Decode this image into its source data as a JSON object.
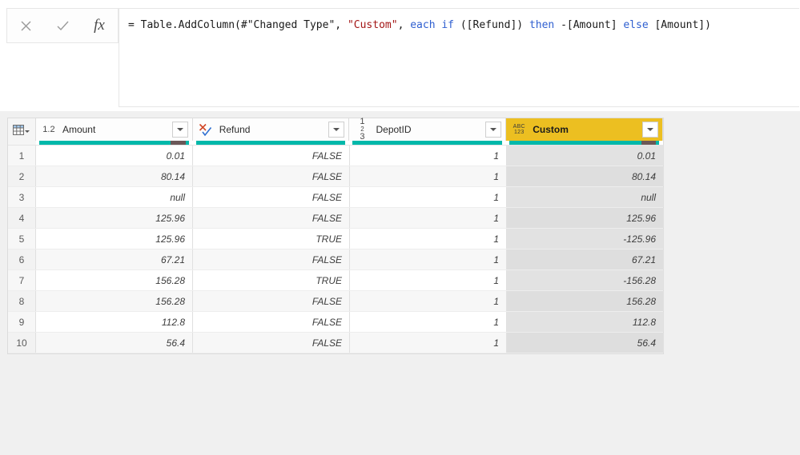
{
  "formula_bar": {
    "cancel_icon": "close-icon",
    "confirm_icon": "checkmark-icon",
    "fx_label": "fx",
    "formula_full": "= Table.AddColumn(#\"Changed Type\", \"Custom\", each if ([Refund]) then -[Amount] else [Amount])",
    "tokens": [
      {
        "text": "= Table.AddColumn(#\"Changed Type\", ",
        "kind": "plain"
      },
      {
        "text": "\"Custom\"",
        "kind": "string"
      },
      {
        "text": ", ",
        "kind": "plain"
      },
      {
        "text": "each",
        "kind": "keyword"
      },
      {
        "text": " ",
        "kind": "plain"
      },
      {
        "text": "if",
        "kind": "keyword"
      },
      {
        "text": " ([Refund]) ",
        "kind": "plain"
      },
      {
        "text": "then",
        "kind": "keyword"
      },
      {
        "text": " -[Amount] ",
        "kind": "plain"
      },
      {
        "text": "else",
        "kind": "keyword"
      },
      {
        "text": " [Amount])",
        "kind": "plain"
      }
    ]
  },
  "grid": {
    "corner_icon": "table-grid-icon",
    "columns": [
      {
        "name": "Amount",
        "type_icon": "decimal-number-icon",
        "type_glyph": "1.2",
        "selected": false,
        "quality": {
          "valid_pct": 88,
          "error_pct": 10
        }
      },
      {
        "name": "Refund",
        "type_icon": "logical-true-false-icon",
        "type_glyph": "X/check",
        "selected": false,
        "quality": {
          "valid_pct": 100,
          "error_pct": 0
        }
      },
      {
        "name": "DepotID",
        "type_icon": "whole-number-icon",
        "type_glyph": "123",
        "selected": false,
        "quality": {
          "valid_pct": 100,
          "error_pct": 0
        }
      },
      {
        "name": "Custom",
        "type_icon": "any-abc123-icon",
        "type_glyph": "ABC123",
        "selected": true,
        "quality": {
          "valid_pct": 88,
          "error_pct": 10
        }
      }
    ],
    "rows": [
      {
        "num": "1",
        "Amount": "0.01",
        "Refund": "FALSE",
        "DepotID": "1",
        "Custom": "0.01"
      },
      {
        "num": "2",
        "Amount": "80.14",
        "Refund": "FALSE",
        "DepotID": "1",
        "Custom": "80.14"
      },
      {
        "num": "3",
        "Amount": "null",
        "Refund": "FALSE",
        "DepotID": "1",
        "Custom": "null"
      },
      {
        "num": "4",
        "Amount": "125.96",
        "Refund": "FALSE",
        "DepotID": "1",
        "Custom": "125.96"
      },
      {
        "num": "5",
        "Amount": "125.96",
        "Refund": "TRUE",
        "DepotID": "1",
        "Custom": "-125.96"
      },
      {
        "num": "6",
        "Amount": "67.21",
        "Refund": "FALSE",
        "DepotID": "1",
        "Custom": "67.21"
      },
      {
        "num": "7",
        "Amount": "156.28",
        "Refund": "TRUE",
        "DepotID": "1",
        "Custom": "-156.28"
      },
      {
        "num": "8",
        "Amount": "156.28",
        "Refund": "FALSE",
        "DepotID": "1",
        "Custom": "156.28"
      },
      {
        "num": "9",
        "Amount": "112.8",
        "Refund": "FALSE",
        "DepotID": "1",
        "Custom": "112.8"
      },
      {
        "num": "10",
        "Amount": "56.4",
        "Refund": "FALSE",
        "DepotID": "1",
        "Custom": "56.4"
      }
    ]
  },
  "colors": {
    "selected_header": "#ecbf21",
    "quality_valid": "#01b8aa",
    "quality_error": "#6b5858",
    "string_token": "#a31515",
    "keyword_token": "#2f5fd0",
    "grid_background": "#f0f0f0"
  }
}
